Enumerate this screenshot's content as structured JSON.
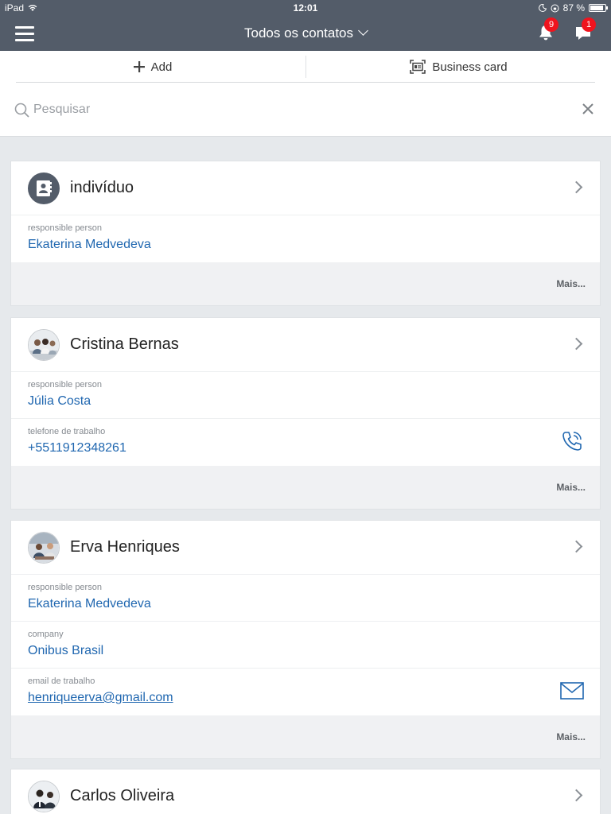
{
  "status": {
    "device": "iPad",
    "time": "12:01",
    "battery": "87 %"
  },
  "header": {
    "title": "Todos os contatos",
    "notifications_count": "9",
    "messages_count": "1"
  },
  "toolbar": {
    "add_label": "Add",
    "card_label": "Business card"
  },
  "search": {
    "placeholder": "Pesquisar",
    "value": ""
  },
  "contacts": [
    {
      "name": "indivíduo",
      "avatar": "contact-card-icon",
      "fields": [
        {
          "label": "responsible person",
          "value": "Ekaterina Medvedeva"
        }
      ],
      "more": "Mais..."
    },
    {
      "name": "Cristina Bernas",
      "avatar": "photo",
      "fields": [
        {
          "label": "responsible person",
          "value": "Júlia Costa"
        },
        {
          "label": "telefone de trabalho",
          "value": "+5511912348261",
          "action": "phone-icon"
        }
      ],
      "more": "Mais..."
    },
    {
      "name": "Erva Henriques",
      "avatar": "photo",
      "fields": [
        {
          "label": "responsible person",
          "value": "Ekaterina Medvedeva"
        },
        {
          "label": "company",
          "value": "Onibus Brasil"
        },
        {
          "label": "email de trabalho",
          "value": "henriqueerva@gmail.com",
          "action": "mail-icon"
        }
      ],
      "more": "Mais..."
    },
    {
      "name": "Carlos Oliveira",
      "avatar": "photo",
      "fields": []
    }
  ],
  "colors": {
    "header_bg": "#535c69",
    "link": "#2067b0",
    "badge": "#f0141e",
    "page_bg": "#e6e9ec"
  }
}
